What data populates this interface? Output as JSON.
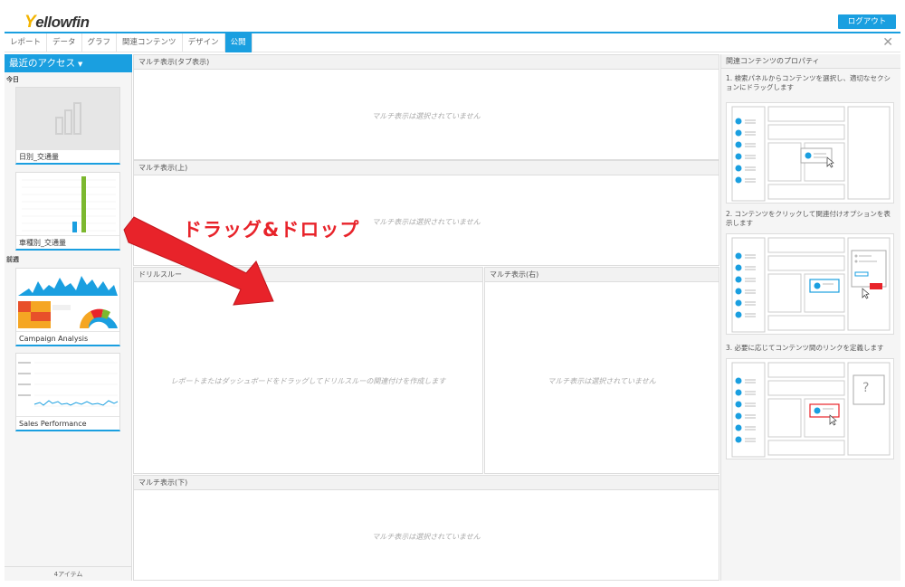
{
  "header": {
    "logo_first": "Y",
    "logo_rest": "ellowfin",
    "logout_label": "ログアウト"
  },
  "tabs": [
    {
      "label": "レポート"
    },
    {
      "label": "データ"
    },
    {
      "label": "グラフ"
    },
    {
      "label": "関連コンテンツ"
    },
    {
      "label": "デザイン"
    },
    {
      "label": "公開"
    }
  ],
  "close_glyph": "✕",
  "sidebar": {
    "title": "最近のアクセス",
    "section_today": "今日",
    "section_lastweek": "前週",
    "cards": [
      {
        "label": "日別_交通量"
      },
      {
        "label": "車種別_交通量"
      },
      {
        "label": "Campaign Analysis"
      },
      {
        "label": "Sales Performance"
      }
    ],
    "footer": "4アイテム"
  },
  "panels": {
    "multi_tab_title": "マルチ表示(タブ表示)",
    "multi_top_title": "マルチ表示(上)",
    "drill_title": "ドリルスルー",
    "multi_right_title": "マルチ表示(右)",
    "multi_bottom_title": "マルチ表示(下)",
    "empty_msg": "マルチ表示は選択されていません",
    "drill_msg": "レポートまたはダッシュボードをドラッグしてドリルスルーの関連付けを作成します"
  },
  "right_panel": {
    "title": "関連コンテンツのプロパティ",
    "step1": "1. 検索パネルからコンテンツを選択し、適切なセクションにドラッグします",
    "step2": "2. コンテンツをクリックして関連付けオプションを表示します",
    "step3": "3. 必要に応じてコンテンツ間のリンクを定義します",
    "question_mark": "?"
  },
  "annotation": {
    "drag_drop": "ドラッグ&ドロップ"
  },
  "colors": {
    "accent": "#1a9fe0",
    "arrow": "#e8232a",
    "logo_yellow": "#f3b400"
  }
}
